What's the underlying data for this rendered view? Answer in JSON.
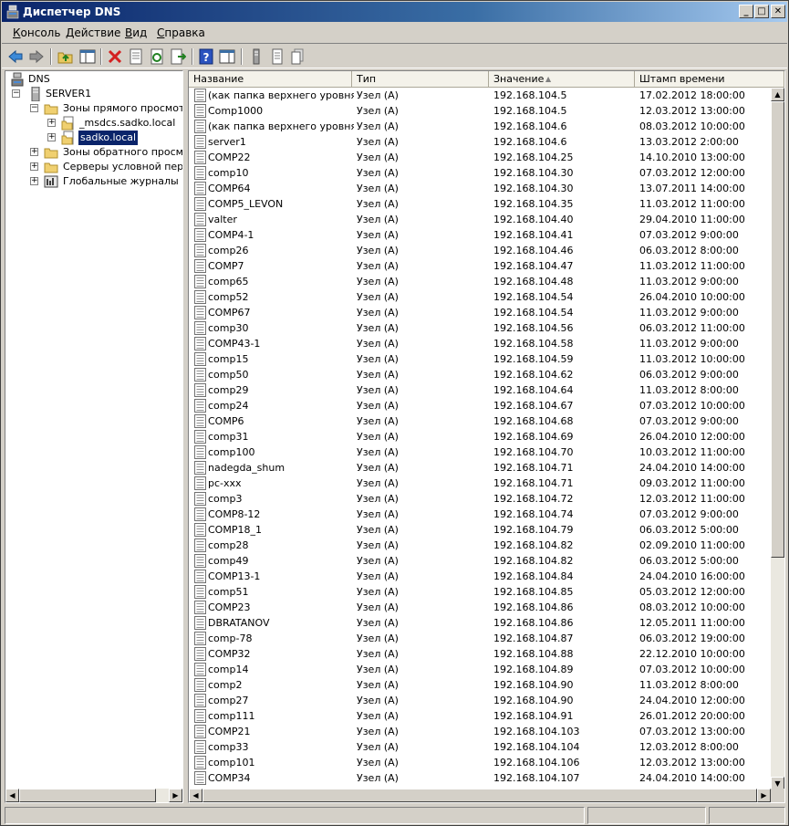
{
  "window": {
    "title": "Диспетчер DNS"
  },
  "menu": [
    {
      "pre": "",
      "ul": "К",
      "post": "онсоль"
    },
    {
      "pre": "",
      "ul": "Д",
      "post": "ействие"
    },
    {
      "pre": "",
      "ul": "В",
      "post": "ид"
    },
    {
      "pre": "",
      "ul": "С",
      "post": "правка"
    }
  ],
  "tree": {
    "root": "DNS",
    "server": "SERVER1",
    "forward": "Зоны прямого просмотра",
    "msdcs": "_msdcs.sadko.local",
    "sadko": "sadko.local",
    "reverse": "Зоны обратного просмотр",
    "conditional": "Серверы условной перес",
    "logs": "Глобальные журналы"
  },
  "table": {
    "headers": [
      "Название",
      "Тип",
      "Значение",
      "Штамп времени"
    ],
    "rows": [
      [
        "(как папка верхнего уровня)",
        "Узел (A)",
        "192.168.104.5",
        "17.02.2012 18:00:00"
      ],
      [
        "Comp1000",
        "Узел (A)",
        "192.168.104.5",
        "12.03.2012 13:00:00"
      ],
      [
        "(как папка верхнего уровня)",
        "Узел (A)",
        "192.168.104.6",
        "08.03.2012 10:00:00"
      ],
      [
        "server1",
        "Узел (A)",
        "192.168.104.6",
        "13.03.2012 2:00:00"
      ],
      [
        "COMP22",
        "Узел (A)",
        "192.168.104.25",
        "14.10.2010 13:00:00"
      ],
      [
        "comp10",
        "Узел (A)",
        "192.168.104.30",
        "07.03.2012 12:00:00"
      ],
      [
        "COMP64",
        "Узел (A)",
        "192.168.104.30",
        "13.07.2011 14:00:00"
      ],
      [
        "COMP5_LEVON",
        "Узел (A)",
        "192.168.104.35",
        "11.03.2012 11:00:00"
      ],
      [
        "valter",
        "Узел (A)",
        "192.168.104.40",
        "29.04.2010 11:00:00"
      ],
      [
        "COMP4-1",
        "Узел (A)",
        "192.168.104.41",
        "07.03.2012 9:00:00"
      ],
      [
        "comp26",
        "Узел (A)",
        "192.168.104.46",
        "06.03.2012 8:00:00"
      ],
      [
        "COMP7",
        "Узел (A)",
        "192.168.104.47",
        "11.03.2012 11:00:00"
      ],
      [
        "comp65",
        "Узел (A)",
        "192.168.104.48",
        "11.03.2012 9:00:00"
      ],
      [
        "comp52",
        "Узел (A)",
        "192.168.104.54",
        "26.04.2010 10:00:00"
      ],
      [
        "COMP67",
        "Узел (A)",
        "192.168.104.54",
        "11.03.2012 9:00:00"
      ],
      [
        "comp30",
        "Узел (A)",
        "192.168.104.56",
        "06.03.2012 11:00:00"
      ],
      [
        "COMP43-1",
        "Узел (A)",
        "192.168.104.58",
        "11.03.2012 9:00:00"
      ],
      [
        "comp15",
        "Узел (A)",
        "192.168.104.59",
        "11.03.2012 10:00:00"
      ],
      [
        "comp50",
        "Узел (A)",
        "192.168.104.62",
        "06.03.2012 9:00:00"
      ],
      [
        "comp29",
        "Узел (A)",
        "192.168.104.64",
        "11.03.2012 8:00:00"
      ],
      [
        "comp24",
        "Узел (A)",
        "192.168.104.67",
        "07.03.2012 10:00:00"
      ],
      [
        "COMP6",
        "Узел (A)",
        "192.168.104.68",
        "07.03.2012 9:00:00"
      ],
      [
        "comp31",
        "Узел (A)",
        "192.168.104.69",
        "26.04.2010 12:00:00"
      ],
      [
        "comp100",
        "Узел (A)",
        "192.168.104.70",
        "10.03.2012 11:00:00"
      ],
      [
        "nadegda_shum",
        "Узел (A)",
        "192.168.104.71",
        "24.04.2010 14:00:00"
      ],
      [
        "pc-xxx",
        "Узел (A)",
        "192.168.104.71",
        "09.03.2012 11:00:00"
      ],
      [
        "comp3",
        "Узел (A)",
        "192.168.104.72",
        "12.03.2012 11:00:00"
      ],
      [
        "COMP8-12",
        "Узел (A)",
        "192.168.104.74",
        "07.03.2012 9:00:00"
      ],
      [
        "COMP18_1",
        "Узел (A)",
        "192.168.104.79",
        "06.03.2012 5:00:00"
      ],
      [
        "comp28",
        "Узел (A)",
        "192.168.104.82",
        "02.09.2010 11:00:00"
      ],
      [
        "comp49",
        "Узел (A)",
        "192.168.104.82",
        "06.03.2012 5:00:00"
      ],
      [
        "COMP13-1",
        "Узел (A)",
        "192.168.104.84",
        "24.04.2010 16:00:00"
      ],
      [
        "comp51",
        "Узел (A)",
        "192.168.104.85",
        "05.03.2012 12:00:00"
      ],
      [
        "COMP23",
        "Узел (A)",
        "192.168.104.86",
        "08.03.2012 10:00:00"
      ],
      [
        "DBRATANOV",
        "Узел (A)",
        "192.168.104.86",
        "12.05.2011 11:00:00"
      ],
      [
        "comp-78",
        "Узел (A)",
        "192.168.104.87",
        "06.03.2012 19:00:00"
      ],
      [
        "COMP32",
        "Узел (A)",
        "192.168.104.88",
        "22.12.2010 10:00:00"
      ],
      [
        "comp14",
        "Узел (A)",
        "192.168.104.89",
        "07.03.2012 10:00:00"
      ],
      [
        "comp2",
        "Узел (A)",
        "192.168.104.90",
        "11.03.2012 8:00:00"
      ],
      [
        "comp27",
        "Узел (A)",
        "192.168.104.90",
        "24.04.2010 12:00:00"
      ],
      [
        "comp111",
        "Узел (A)",
        "192.168.104.91",
        "26.01.2012 20:00:00"
      ],
      [
        "COMP21",
        "Узел (A)",
        "192.168.104.103",
        "07.03.2012 13:00:00"
      ],
      [
        "comp33",
        "Узел (A)",
        "192.168.104.104",
        "12.03.2012 8:00:00"
      ],
      [
        "comp101",
        "Узел (A)",
        "192.168.104.106",
        "12.03.2012 13:00:00"
      ],
      [
        "COMP34",
        "Узел (A)",
        "192.168.104.107",
        "24.04.2010 14:00:00"
      ]
    ]
  },
  "sort": {
    "column": "Значение",
    "direction": "ascending"
  },
  "colors": {
    "title_start": "#0a246a",
    "title_end": "#a6caf0",
    "selection": "#0a246a",
    "delete": "#d42020",
    "help": "#2a52be"
  }
}
